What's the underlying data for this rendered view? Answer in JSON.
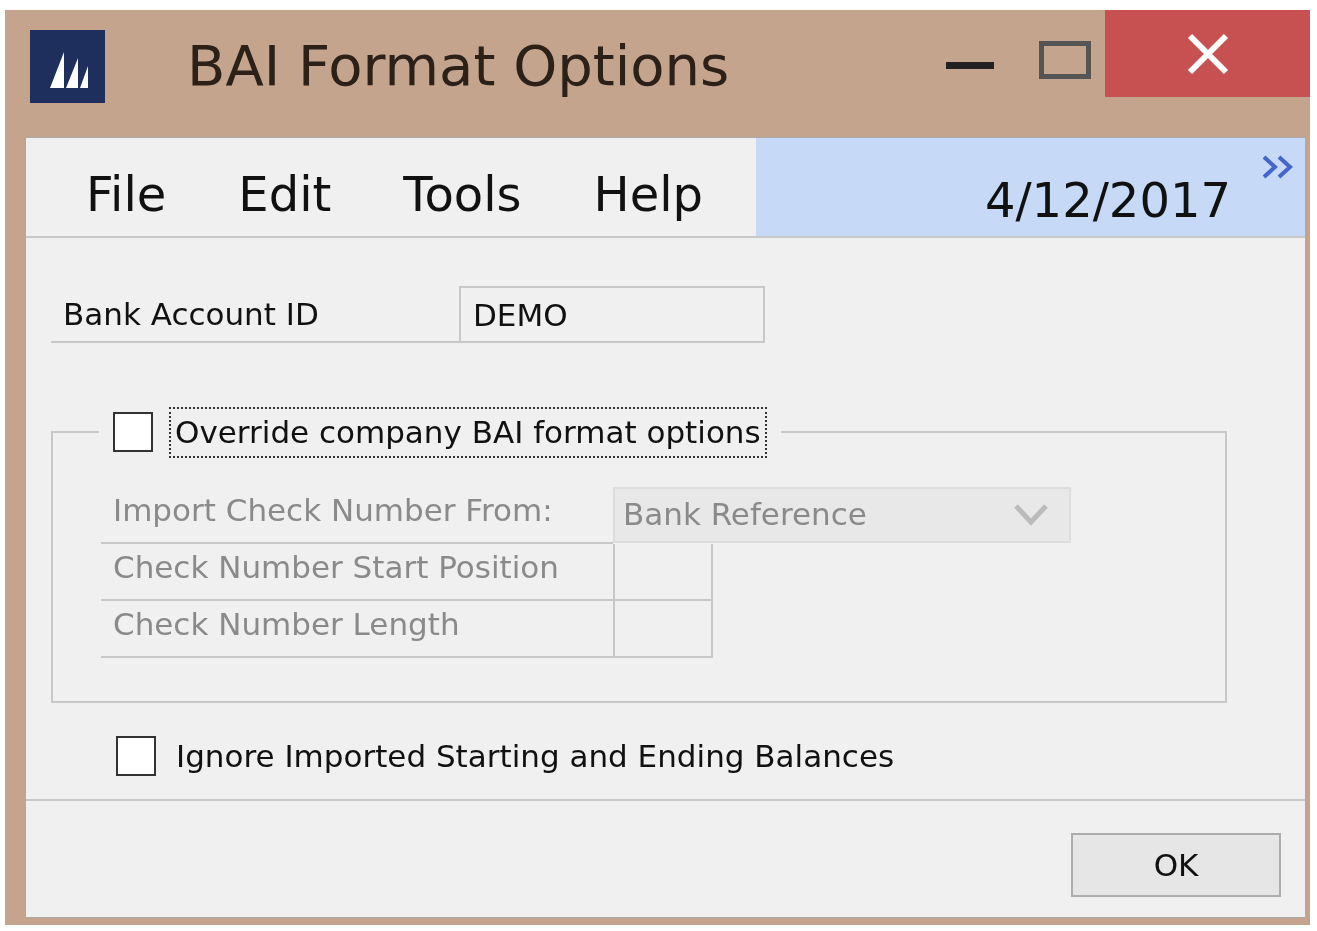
{
  "window": {
    "title": "BAI Format Options"
  },
  "menu": [
    "File",
    "Edit",
    "Tools",
    "Help"
  ],
  "date": "4/12/2017",
  "bank_account": {
    "label": "Bank Account ID",
    "value": "DEMO"
  },
  "override": {
    "label": "Override company BAI format options",
    "checked": false,
    "focused": true,
    "disabled_fields": true
  },
  "import_from": {
    "label": "Import Check Number From:",
    "value": "Bank Reference"
  },
  "start_position": {
    "label": "Check Number Start Position"
  },
  "length": {
    "label": "Check Number Length"
  },
  "ignore_balances": {
    "label": "Ignore Imported Starting and Ending Balances",
    "checked": false
  },
  "buttons": [
    "OK"
  ]
}
